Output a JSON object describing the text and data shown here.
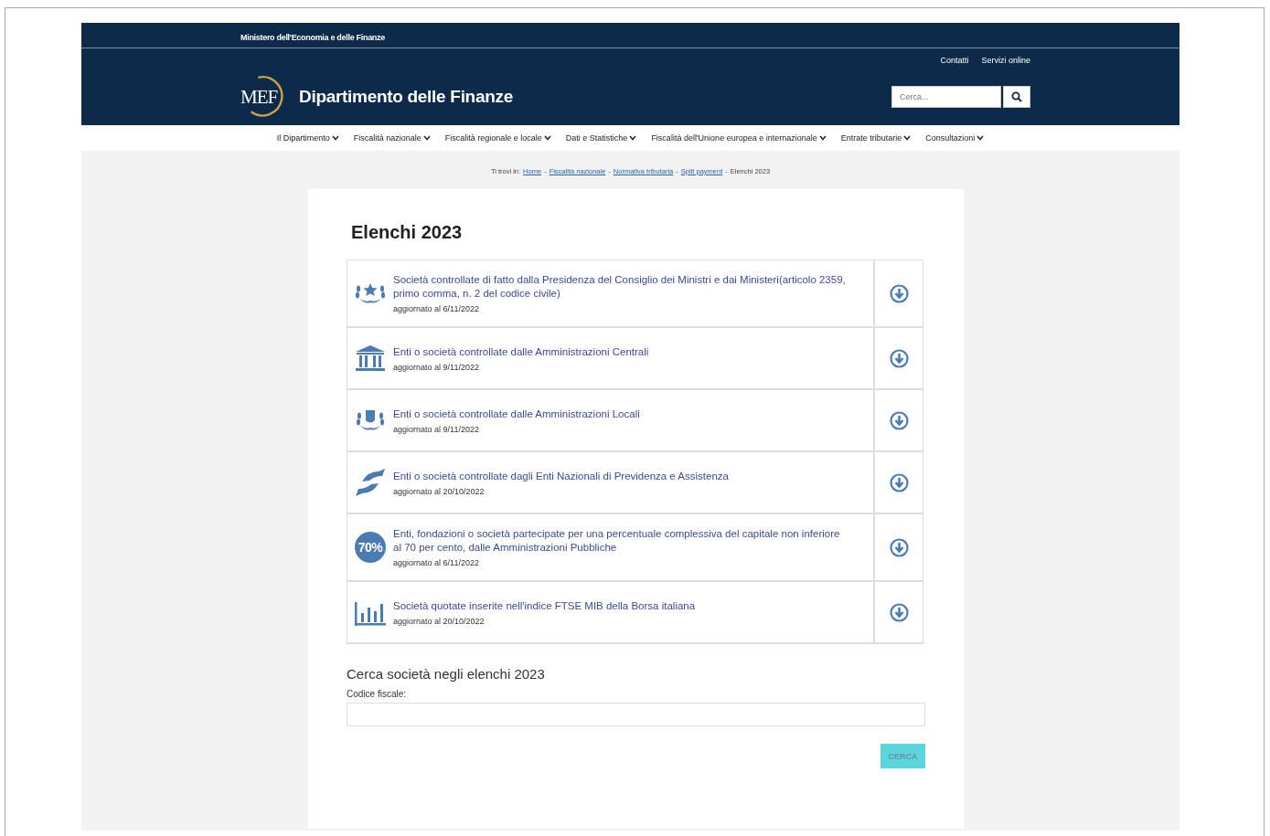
{
  "top_bar": {
    "ministry": "Ministero dell'Economia e delle Finanze"
  },
  "header": {
    "utility_links": [
      "Contatti",
      "Servizi online"
    ],
    "logo_text": "MEF",
    "site_title": "Dipartimento delle Finanze",
    "search": {
      "placeholder": "Cerca..."
    }
  },
  "nav": [
    "Il Dipartimento",
    "Fiscalità nazionale",
    "Fiscalità regionale e locale",
    "Dati e Statistiche",
    "Fiscalità dell'Unione europea e internazionale",
    "Entrate tributarie",
    "Consultazioni"
  ],
  "breadcrumb": {
    "label": "Ti trovi in:",
    "items": [
      {
        "text": "Home",
        "kind": "link"
      },
      {
        "text": "-",
        "kind": "separator"
      },
      {
        "text": "Fiscalità nazionale",
        "kind": "link"
      },
      {
        "text": "-",
        "kind": "separator"
      },
      {
        "text": "Normativa tributaria",
        "kind": "link"
      },
      {
        "text": "-",
        "kind": "separator"
      },
      {
        "text": "Split payment",
        "kind": "link"
      },
      {
        "text": "-",
        "kind": "separator"
      },
      {
        "text": "Elenchi 2023",
        "kind": "current"
      }
    ]
  },
  "page_title": "Elenchi 2023",
  "lists": [
    {
      "kind": "laurel-star",
      "title": "Società controllate di fatto dalla Presidenza del Consiglio dei Ministri e dai Ministeri(articolo 2359, primo comma, n. 2 del codice civile)",
      "updated": "aggiornato al 6/11/2022"
    },
    {
      "kind": "temple",
      "title": "Enti o società controllate dalle Amministrazioni Centrali",
      "updated": "aggiornato al 9/11/2022"
    },
    {
      "kind": "laurel-shield",
      "title": "Enti o società controllate dalle Amministrazioni Locali",
      "updated": "aggiornato al 9/11/2022"
    },
    {
      "kind": "hands",
      "title": "Enti o società controllate dagli Enti Nazionali di Previdenza e Assistenza",
      "updated": "aggiornato al 20/10/2022"
    },
    {
      "kind": "percent",
      "icon_text": "70%",
      "title": "Enti, fondazioni o società partecipate per una percentuale complessiva del capitale non inferiore al 70 per cento, dalle Amministrazioni Pubbliche",
      "updated": "aggiornato al 6/11/2022"
    },
    {
      "kind": "bars",
      "title": "Società quotate inserite nell'indice FTSE MIB della Borsa italiana",
      "updated": "aggiornato al 20/10/2022"
    }
  ],
  "search_form": {
    "heading": "Cerca società negli elenchi 2023",
    "label": "Codice fiscale:",
    "button": {
      "label": "CERCA",
      "disabled": true
    }
  }
}
